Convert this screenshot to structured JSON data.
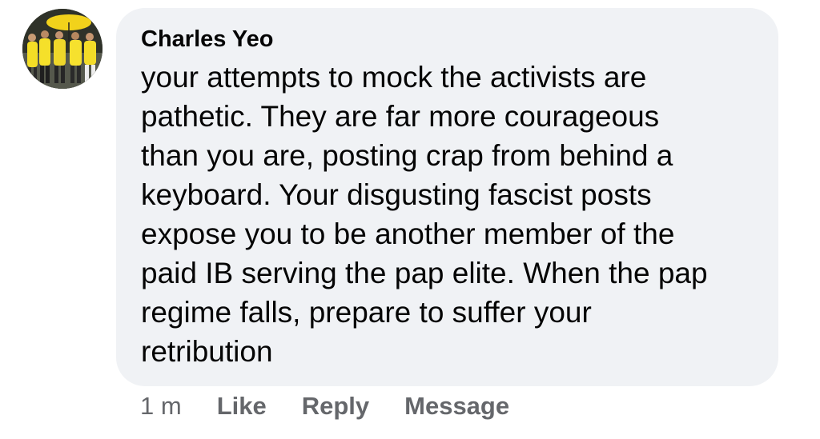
{
  "comment": {
    "author": "Charles Yeo",
    "text_lines": [
      "your attempts to mock the activists are",
      "pathetic. They are far more courageous",
      "than you are, posting crap from behind a",
      "keyboard. Your disgusting fascist posts",
      "expose you to be another member of the",
      "paid IB serving the pap elite. When the pap",
      "regime falls, prepare to suffer your",
      "retribution"
    ],
    "timestamp": "1 m",
    "actions": {
      "like": "Like",
      "reply": "Reply",
      "message": "Message"
    }
  },
  "colors": {
    "bubble": "#f0f2f5",
    "text": "#050505",
    "meta": "#65676b"
  }
}
